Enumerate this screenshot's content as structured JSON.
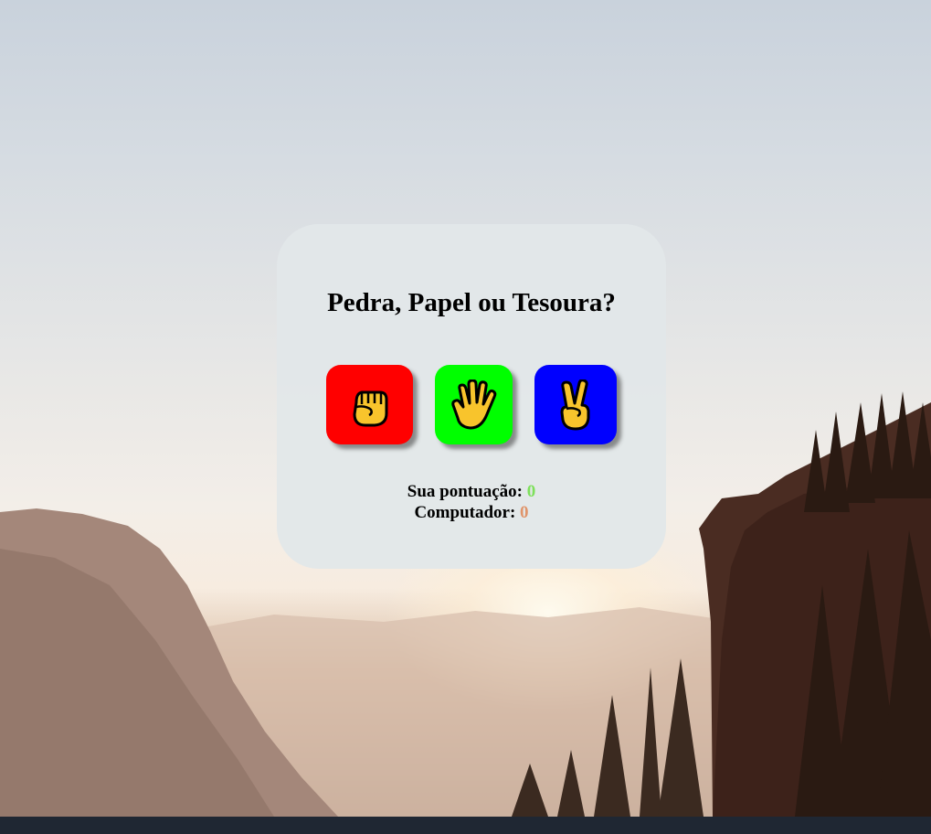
{
  "game": {
    "title": "Pedra, Papel ou Tesoura?",
    "choices": [
      {
        "name": "rock",
        "icon": "fist-icon",
        "color": "#ff0000"
      },
      {
        "name": "paper",
        "icon": "open-hand-icon",
        "color": "#00ff00"
      },
      {
        "name": "scissors",
        "icon": "victory-hand-icon",
        "color": "#0000ff"
      }
    ]
  },
  "score": {
    "user_label": "Sua pontuação:",
    "user_value": "0",
    "cpu_label": "Computador:",
    "cpu_value": "0",
    "user_color": "#7ee05b",
    "cpu_color": "#e0946a"
  }
}
